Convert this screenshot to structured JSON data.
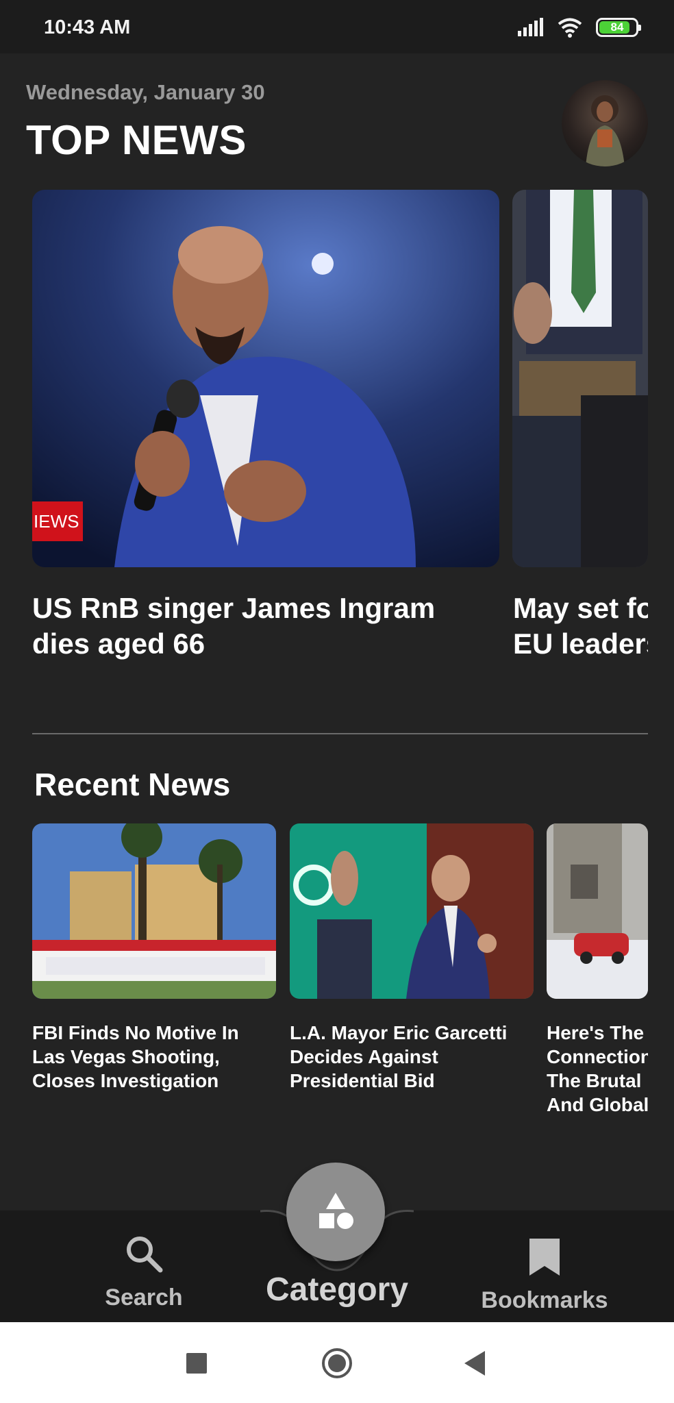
{
  "status_bar": {
    "time": "10:43 AM",
    "battery_level": "84",
    "battery_color": "#4cd137"
  },
  "header": {
    "date": "Wednesday, January 30",
    "title": "TOP NEWS",
    "avatar_icon": "user-avatar"
  },
  "top_news": [
    {
      "headline": "US RnB singer James Ingram dies aged 66",
      "tag": "IEWS"
    },
    {
      "headline_line1": "May set fo",
      "headline_line2": "EU leaders"
    }
  ],
  "recent": {
    "title": "Recent News",
    "items": [
      {
        "headline": "FBI Finds No Motive In Las Vegas Shooting, Closes Investigation"
      },
      {
        "headline": "L.A. Mayor Eric Garcetti Decides Against Presidential Bid"
      },
      {
        "line1": "Here's The",
        "line2": "Connection",
        "line3": "The Brutal",
        "line4": "And Global"
      }
    ]
  },
  "bottom_nav": {
    "search_label": "Search",
    "category_label": "Category",
    "bookmarks_label": "Bookmarks"
  },
  "colors": {
    "background": "#232323",
    "nav_background": "#1a1a1a",
    "fab": "#8e8e8e",
    "news_tag": "#d0121b"
  }
}
